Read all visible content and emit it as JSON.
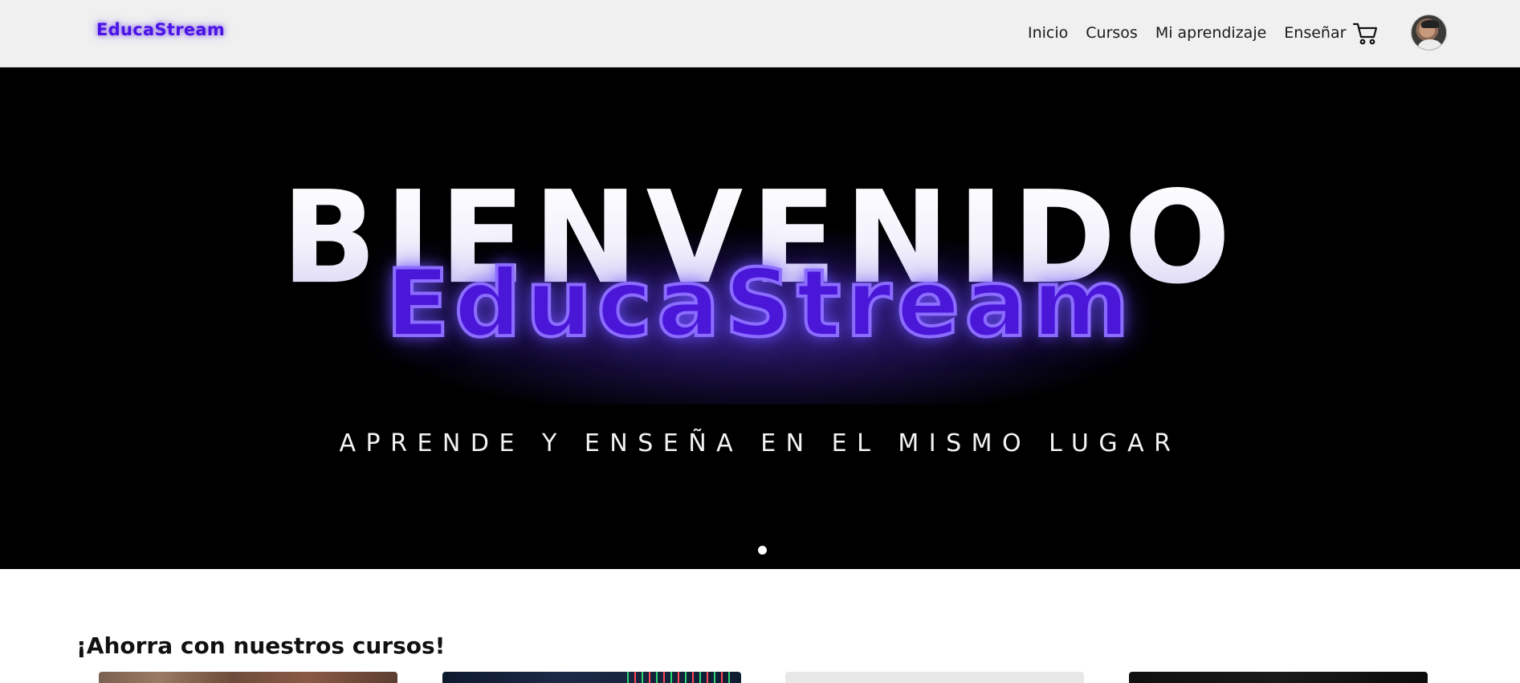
{
  "header": {
    "brand": "EducaStream",
    "nav": [
      "Inicio",
      "Cursos",
      "Mi aprendizaje",
      "Enseñar"
    ],
    "cart_icon": "shopping-cart-icon",
    "avatar_icon": "user-avatar"
  },
  "hero": {
    "title": "BIENVENIDO",
    "brand": "EducaStream",
    "subtitle": "APRENDE Y ENSEÑA EN EL MISMO LUGAR",
    "active_slide": 1,
    "slide_count": 1,
    "colors": {
      "background": "#000000",
      "brand_purple": "#4a16d8",
      "brand_outline": "#8b6cff"
    }
  },
  "section": {
    "title": "¡Ahorra con nuestros cursos!",
    "cards": [
      {
        "thumbnail": "food-photo"
      },
      {
        "thumbnail": "trading-chart-photo"
      },
      {
        "thumbnail": "light-gray-photo"
      },
      {
        "thumbnail": "dark-photo"
      }
    ]
  }
}
